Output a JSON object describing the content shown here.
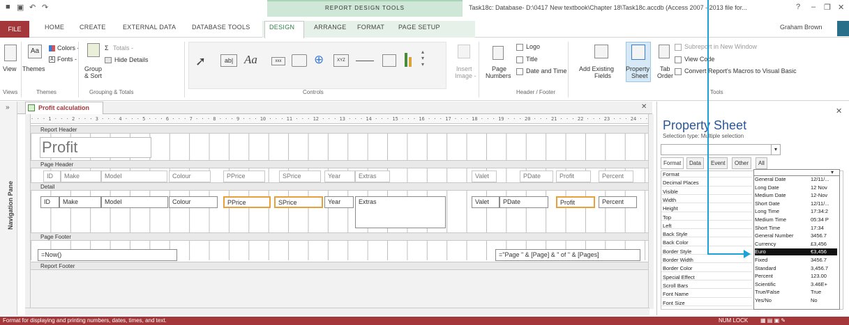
{
  "window": {
    "title": "Task18c: Database- D:\\0417 New textbook\\Chapter 18\\Task18c.accdb (Access 2007 - 2013 file for...",
    "context_tools": "REPORT DESIGN TOOLS",
    "user": "Graham Brown",
    "help": "?",
    "minimize": "–",
    "restore": "❐",
    "close": "✕"
  },
  "qat": {
    "undo": "↶",
    "redo": "↷",
    "save": "▣"
  },
  "tabs": {
    "file": "FILE",
    "home": "HOME",
    "create": "CREATE",
    "external_data": "EXTERNAL DATA",
    "database_tools": "DATABASE TOOLS",
    "design": "DESIGN",
    "arrange": "ARRANGE",
    "format": "FORMAT",
    "page_setup": "PAGE SETUP"
  },
  "ribbon": {
    "views": {
      "view": "View",
      "group": "Views"
    },
    "themes": {
      "themes": "Themes",
      "colors": "Colors -",
      "fonts": "Fonts -",
      "group": "Themes"
    },
    "grouping": {
      "group_sort": "Group",
      "group_sort2": "& Sort",
      "totals": "Totals -",
      "hide_details": "Hide Details",
      "group": "Grouping & Totals"
    },
    "controls": {
      "group": "Controls",
      "insert_image": "Insert",
      "insert_image2": "Image -"
    },
    "header_footer": {
      "page_numbers": "Page",
      "page_numbers2": "Numbers",
      "logo": "Logo",
      "title": "Title",
      "date_time": "Date and Time",
      "group": "Header / Footer"
    },
    "tools": {
      "add_existing": "Add Existing",
      "add_existing2": "Fields",
      "property_sheet": "Property",
      "property_sheet2": "Sheet",
      "tab_order": "Tab",
      "tab_order2": "Order",
      "subreport": "Subreport in New Window",
      "view_code": "View Code",
      "convert": "Convert Report's Macros to Visual Basic",
      "group": "Tools"
    }
  },
  "nav_pane": {
    "label": "Navigation Pane",
    "toggle": "»"
  },
  "report": {
    "tab_label": "Profit calculation",
    "ruler": "· · · 1 · · · 2 · · · 3 · · · 4 · · · 5 · · · 6 · · · 7 · · · 8 · · · 9 · · · 10 · · · 11 · · · 12 · · · 13 · · · 14 · · · 15 · · · 16 · · · 17 · · · 18 · · · 19 · · · 20 · · · 21 · · · 22 · · · 23 · · · 24 · · · 25 · · · 26 · ·",
    "sections": {
      "report_header": "Report Header",
      "page_header": "Page Header",
      "detail": "Detail",
      "page_footer": "Page Footer",
      "report_footer": "Report Footer"
    },
    "title": "Profit calculation",
    "page_header_labels": [
      "ID",
      "Make",
      "Model",
      "Colour",
      "PPrice",
      "SPrice",
      "Year",
      "Extras",
      "Valet",
      "PDate",
      "Profit",
      "Percent"
    ],
    "detail_fields": [
      "ID",
      "Make",
      "Model",
      "Colour",
      "PPrice",
      "SPrice",
      "Year",
      "Extras",
      "Valet",
      "PDate",
      "Profit",
      "Percent"
    ],
    "footer_now": "=Now()",
    "footer_page": "=\"Page \" & [Page] & \" of \" & [Pages]"
  },
  "property_sheet": {
    "title": "Property Sheet",
    "selection_type": "Selection type:  Multiple selection",
    "tabs": [
      "Format",
      "Data",
      "Event",
      "Other",
      "All"
    ],
    "close": "✕",
    "properties": [
      "Format",
      "Decimal Places",
      "Visible",
      "Width",
      "Height",
      "Top",
      "Left",
      "Back Style",
      "Back Color",
      "Border Style",
      "Border Width",
      "Border Color",
      "Special Effect",
      "Scroll Bars",
      "Font Name",
      "Font Size"
    ],
    "format_options": [
      {
        "name": "General Date",
        "example": "12/11/..."
      },
      {
        "name": "Long Date",
        "example": "12 Nov"
      },
      {
        "name": "Medium Date",
        "example": "12-Nov"
      },
      {
        "name": "Short Date",
        "example": "12/11/..."
      },
      {
        "name": "Long Time",
        "example": "17:34:2"
      },
      {
        "name": "Medium Time",
        "example": "05:34 P"
      },
      {
        "name": "Short Time",
        "example": "17:34"
      },
      {
        "name": "General Number",
        "example": "3456.7"
      },
      {
        "name": "Currency",
        "example": "£3,456"
      },
      {
        "name": "Euro",
        "example": "€3,456"
      },
      {
        "name": "Fixed",
        "example": "3456.7"
      },
      {
        "name": "Standard",
        "example": "3,456.7"
      },
      {
        "name": "Percent",
        "example": "123.00"
      },
      {
        "name": "Scientific",
        "example": "3.46E+"
      },
      {
        "name": "True/False",
        "example": "True"
      },
      {
        "name": "Yes/No",
        "example": "No"
      }
    ],
    "selected_option": "Euro"
  },
  "status": {
    "left": "Format for displaying and printing numbers, dates, times, and text.",
    "num_lock": "NUM LOCK"
  },
  "colors": {
    "accent": "#a4373a",
    "annotation": "#1aa3d9",
    "selected_control": "#e8a13a"
  }
}
